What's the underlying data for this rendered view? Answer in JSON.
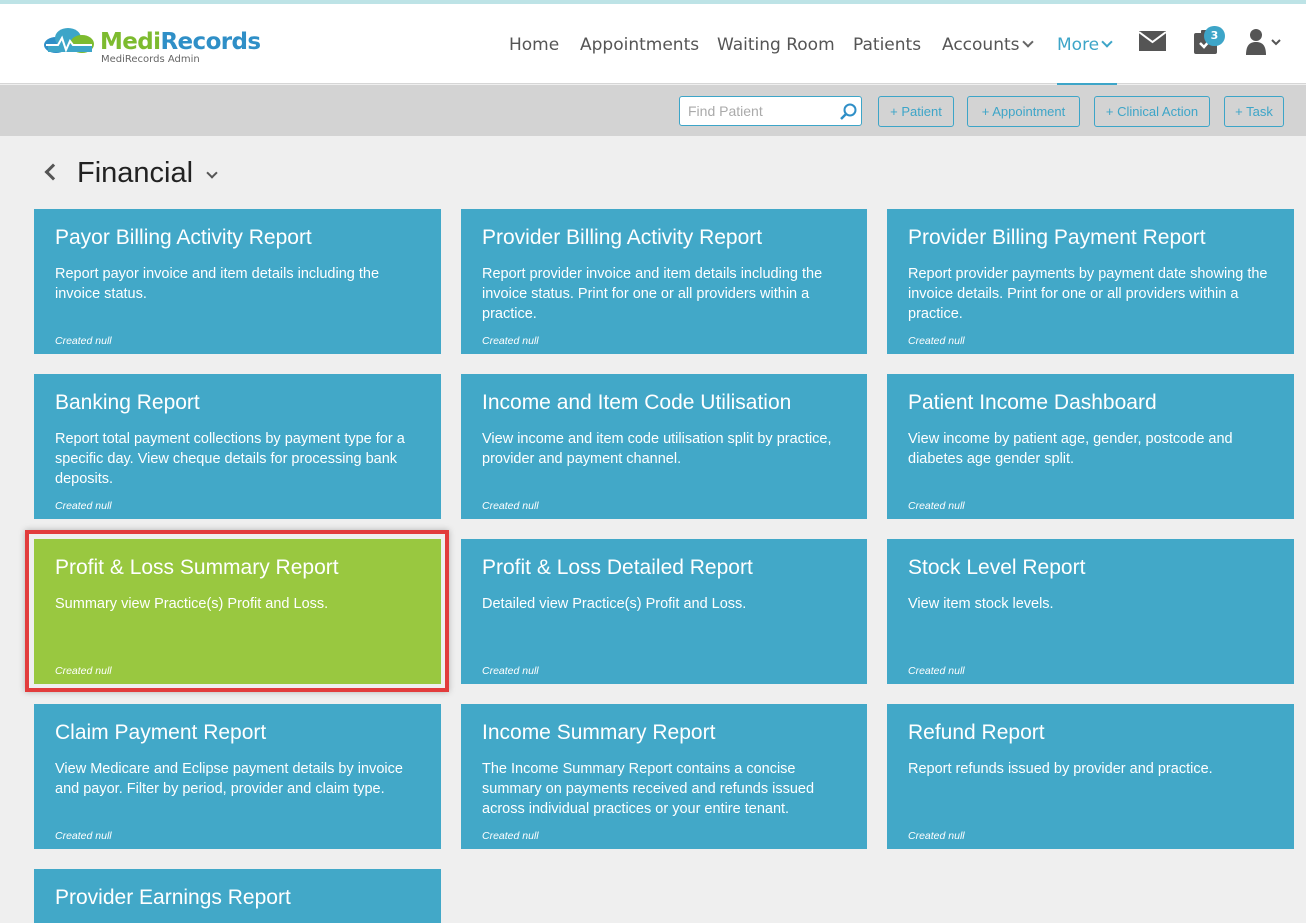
{
  "app": {
    "brand_part1": "Medi",
    "brand_part2": "Records",
    "subtitle": "MediRecords Admin"
  },
  "nav": {
    "items": [
      {
        "label": "Home"
      },
      {
        "label": "Appointments"
      },
      {
        "label": "Waiting Room"
      },
      {
        "label": "Patients"
      },
      {
        "label": "Accounts"
      },
      {
        "label": "More"
      }
    ],
    "active": "More",
    "tasks_badge": "3",
    "icons": [
      "mail-icon",
      "tasks-icon",
      "user-icon"
    ]
  },
  "actions": {
    "search_placeholder": "Find Patient",
    "buttons": [
      "+ Patient",
      "+ Appointment",
      "+ Clinical Action",
      "+ Task"
    ]
  },
  "page": {
    "title": "Financial"
  },
  "reports": [
    {
      "title": "Payor Billing Activity Report",
      "description": "Report payor invoice and item details including the invoice status.",
      "footer": "Created null"
    },
    {
      "title": "Provider Billing Activity Report",
      "description": "Report provider invoice and item details including the invoice status. Print for one or all providers within a practice.",
      "footer": "Created null"
    },
    {
      "title": "Provider Billing Payment Report",
      "description": "Report provider payments by payment date showing the invoice details. Print for one or all providers within a practice.",
      "footer": "Created null"
    },
    {
      "title": "Banking Report",
      "description": "Report total payment collections by payment type for a specific day. View cheque details for processing bank deposits.",
      "footer": "Created null"
    },
    {
      "title": "Income and Item Code Utilisation",
      "description": "View income and item code utilisation split by practice, provider and payment channel.",
      "footer": "Created null"
    },
    {
      "title": "Patient Income Dashboard",
      "description": "View income by patient age, gender, postcode and diabetes age gender split.",
      "footer": "Created null"
    },
    {
      "title": "Profit & Loss Summary Report",
      "description": "Summary view Practice(s) Profit and Loss.",
      "footer": "Created null",
      "highlighted": true
    },
    {
      "title": "Profit & Loss Detailed Report",
      "description": "Detailed view Practice(s) Profit and Loss.",
      "footer": "Created null"
    },
    {
      "title": "Stock Level Report",
      "description": "View item stock levels.",
      "footer": "Created null"
    },
    {
      "title": "Claim Payment Report",
      "description": "View Medicare and Eclipse payment details by invoice and payor. Filter by period, provider and claim type.",
      "footer": "Created null"
    },
    {
      "title": "Income Summary Report",
      "description": "The Income Summary Report contains a concise summary on payments received and refunds issued across individual practices or your entire tenant.",
      "footer": "Created null"
    },
    {
      "title": "Refund Report",
      "description": "Report refunds issued by provider and practice.",
      "footer": "Created null"
    },
    {
      "title": "Provider Earnings Report",
      "description": "",
      "footer": ""
    }
  ],
  "colors": {
    "card": "#42a8c8",
    "card_highlight": "#99c840",
    "accent": "#3da5c8",
    "highlight_border": "#e23c3c"
  }
}
